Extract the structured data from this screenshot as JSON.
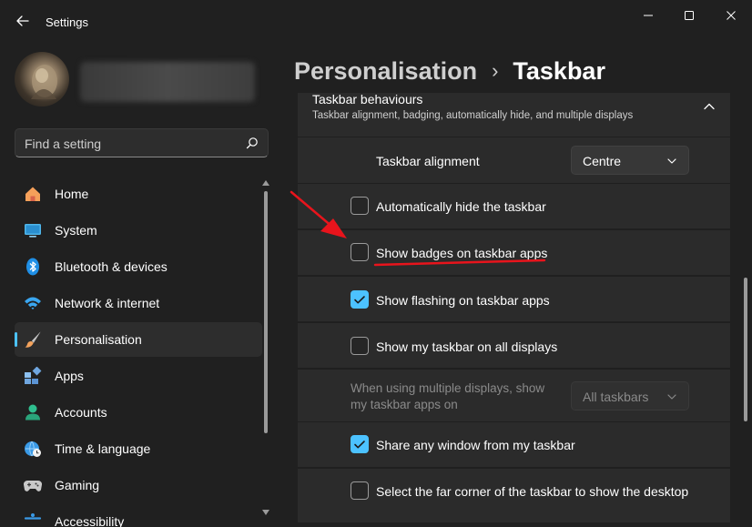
{
  "window": {
    "title": "Settings",
    "controls": [
      "minimize-icon",
      "maximize-icon",
      "close-icon"
    ]
  },
  "search": {
    "placeholder": "Find a setting"
  },
  "sidebar": {
    "items": [
      {
        "label": "Home",
        "icon": "home-icon",
        "active": false
      },
      {
        "label": "System",
        "icon": "system-icon",
        "active": false
      },
      {
        "label": "Bluetooth & devices",
        "icon": "bluetooth-icon",
        "active": false
      },
      {
        "label": "Network & internet",
        "icon": "wifi-icon",
        "active": false
      },
      {
        "label": "Personalisation",
        "icon": "brush-icon",
        "active": true
      },
      {
        "label": "Apps",
        "icon": "apps-icon",
        "active": false
      },
      {
        "label": "Accounts",
        "icon": "account-icon",
        "active": false
      },
      {
        "label": "Time & language",
        "icon": "globe-clock-icon",
        "active": false
      },
      {
        "label": "Gaming",
        "icon": "gamepad-icon",
        "active": false
      },
      {
        "label": "Accessibility",
        "icon": "accessibility-icon",
        "active": false
      }
    ]
  },
  "breadcrumb": {
    "parent": "Personalisation",
    "separator": "›",
    "current": "Taskbar"
  },
  "section": {
    "title": "Taskbar behaviours",
    "subtitle": "Taskbar alignment, badging, automatically hide, and multiple displays"
  },
  "settings": {
    "alignment_label": "Taskbar alignment",
    "alignment_value": "Centre",
    "auto_hide": {
      "label": "Automatically hide the taskbar",
      "checked": false
    },
    "badges": {
      "label": "Show badges on taskbar apps",
      "checked": false
    },
    "flashing": {
      "label": "Show flashing on taskbar apps",
      "checked": true
    },
    "all_displays": {
      "label": "Show my taskbar on all displays",
      "checked": false
    },
    "multi_display_line1": "When using multiple displays, show",
    "multi_display_line2": "my taskbar apps on",
    "multi_display_value": "All taskbars",
    "share_window": {
      "label": "Share any window from my taskbar",
      "checked": true
    },
    "far_corner": {
      "label": "Select the far corner of the taskbar to show the desktop",
      "checked": false
    }
  },
  "colors": {
    "background": "#202020",
    "card": "#2b2b2b",
    "accent": "#4cc2ff",
    "annotation": "#e8141c"
  }
}
